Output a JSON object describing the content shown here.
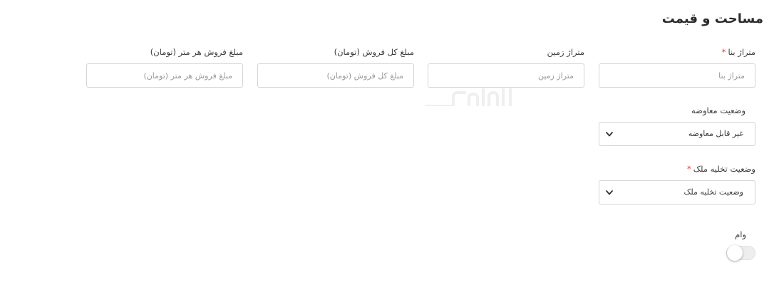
{
  "section": {
    "title": "مساحت و قیمت"
  },
  "fields": {
    "building_area": {
      "label": "متراژ بنا",
      "required": true,
      "placeholder": "متراژ بنا",
      "value": ""
    },
    "land_area": {
      "label": "متراژ زمین",
      "required": false,
      "placeholder": "متراژ زمین",
      "value": ""
    },
    "total_price": {
      "label": "مبلغ کل فروش (تومان)",
      "required": false,
      "placeholder": "مبلغ کل فروش (تومان)",
      "value": ""
    },
    "price_per_meter": {
      "label": "مبلغ فروش هر متر (تومان)",
      "required": false,
      "placeholder": "مبلغ فروش هر متر (تومان)",
      "value": ""
    },
    "exchange_status": {
      "label": "وضعیت معاوضه",
      "required": false,
      "selected": "غیر قابل معاوضه"
    },
    "vacancy_status": {
      "label": "وضعیت تخلیه ملک",
      "required": true,
      "selected": "وضعیت تخلیه ملک"
    },
    "loan": {
      "label": "وام",
      "enabled": false
    }
  },
  "required_marker": "*",
  "watermark": {
    "text": "الفاملک"
  },
  "colors": {
    "required": "#e53935",
    "border": "#d4d4d4",
    "toggle_track": "#eeeeee"
  }
}
